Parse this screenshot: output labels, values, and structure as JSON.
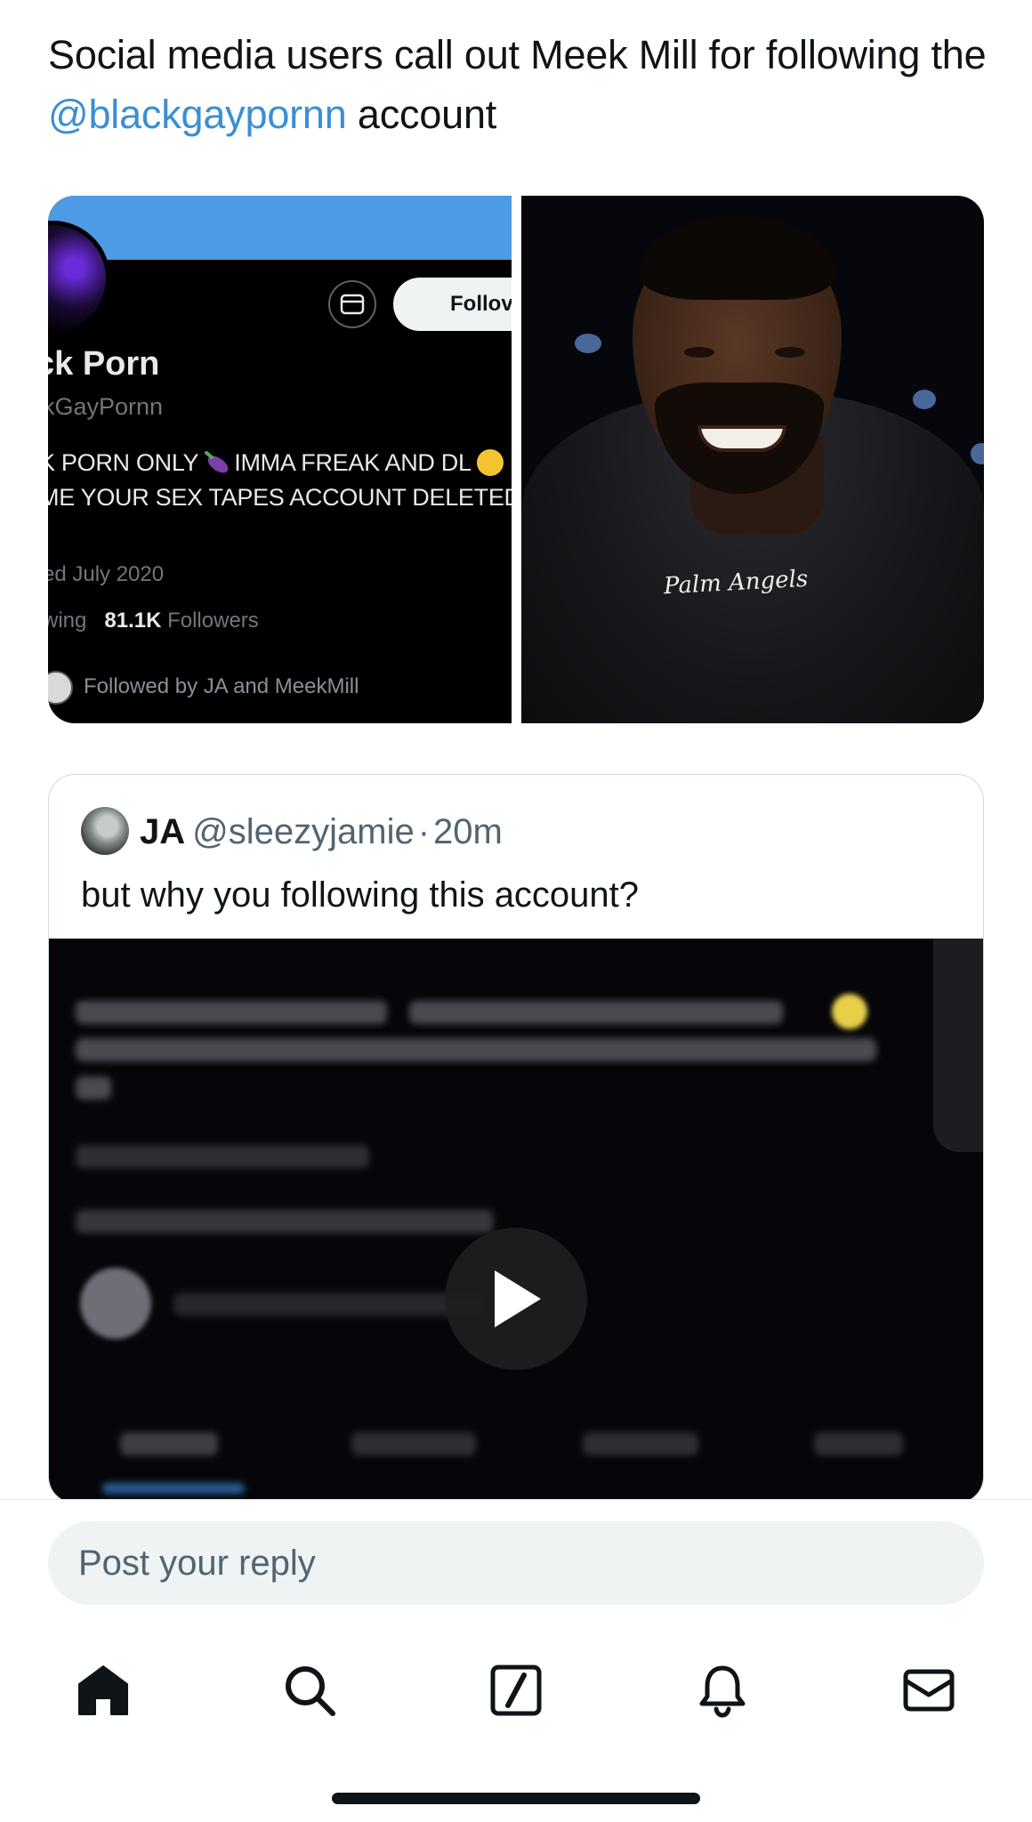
{
  "tweet": {
    "text_before": "Social media users call out Meek Mill for following the ",
    "mention": "@blackgaypornn",
    "text_after": " account"
  },
  "media_left": {
    "follow_label": "Follov",
    "profile_name": "ck Porn",
    "profile_handle": "kGayPornn",
    "bio_line1_a": "K PORN ONLY",
    "bio_line1_b": "IMMA FREAK AND DL",
    "bio_line2": "ME YOUR SEX TAPES ACCOUNT DELETED",
    "joined": "ed July 2020",
    "following_label": "wing",
    "followers_count": "81.1K",
    "followers_label": "Followers",
    "followed_by": "Followed by JA and MeekMill"
  },
  "media_right": {
    "hoodie_logo": "Palm Angels"
  },
  "quote": {
    "name": "JA",
    "handle": "@sleezyjamie",
    "separator": "·",
    "time": "20m",
    "text": "but why you following this account?"
  },
  "reply": {
    "placeholder": "Post your reply"
  },
  "nav": {
    "items": [
      "home-icon",
      "search-icon",
      "compose-icon",
      "notifications-icon",
      "messages-icon"
    ]
  },
  "colors": {
    "mention": "#3b8fd3",
    "banner": "#4d9be5",
    "text": "#0f1419",
    "secondary_text": "#536471"
  }
}
